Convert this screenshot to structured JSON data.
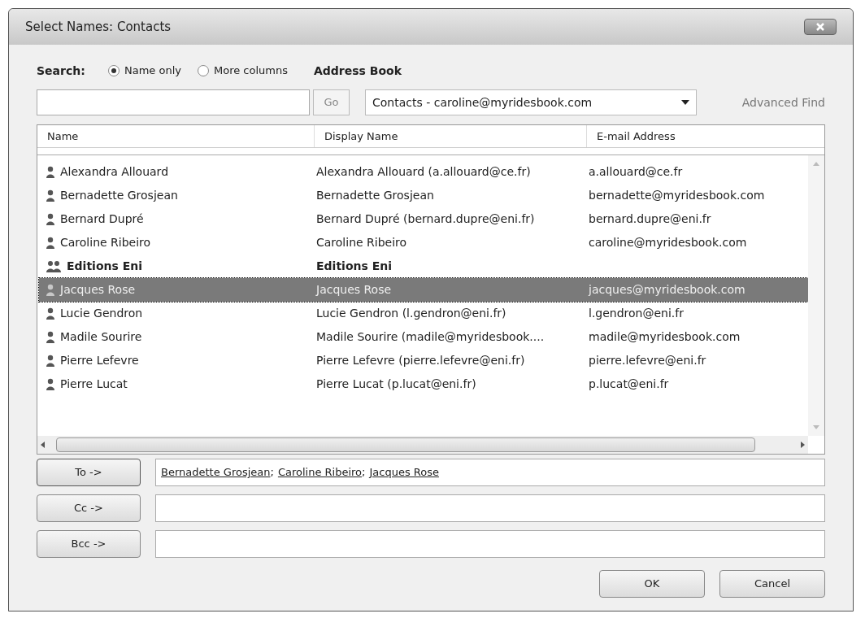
{
  "window": {
    "title": "Select Names: Contacts"
  },
  "search": {
    "label": "Search:",
    "options": [
      {
        "label": "Name only",
        "selected": true
      },
      {
        "label": "More columns",
        "selected": false
      }
    ],
    "go": "Go"
  },
  "address_book": {
    "label": "Address Book",
    "value": "Contacts - caroline@myridesbook.com",
    "advanced_find": "Advanced Find"
  },
  "table": {
    "columns": [
      "Name",
      "Display Name",
      "E-mail Address"
    ],
    "rows": [
      {
        "kind": "contact",
        "selected": false,
        "cells": [
          "Alexandra Allouard",
          "Alexandra Allouard (a.allouard@ce.fr)",
          "a.allouard@ce.fr"
        ]
      },
      {
        "kind": "contact",
        "selected": false,
        "cells": [
          "Bernadette Grosjean",
          "Bernadette Grosjean",
          "bernadette@myridesbook.com"
        ]
      },
      {
        "kind": "contact",
        "selected": false,
        "cells": [
          "Bernard Dupré",
          "Bernard Dupré (bernard.dupre@eni.fr)",
          "bernard.dupre@eni.fr"
        ]
      },
      {
        "kind": "contact",
        "selected": false,
        "cells": [
          "Caroline Ribeiro",
          "Caroline Ribeiro",
          "caroline@myridesbook.com"
        ]
      },
      {
        "kind": "group",
        "selected": false,
        "cells": [
          "Editions Eni",
          "Editions Eni",
          ""
        ]
      },
      {
        "kind": "contact",
        "selected": true,
        "cells": [
          "Jacques Rose",
          "Jacques Rose",
          "jacques@myridesbook.com"
        ]
      },
      {
        "kind": "contact",
        "selected": false,
        "cells": [
          "Lucie Gendron",
          "Lucie Gendron (l.gendron@eni.fr)",
          "l.gendron@eni.fr"
        ]
      },
      {
        "kind": "contact",
        "selected": false,
        "cells": [
          "Madile Sourire",
          "Madile Sourire (madile@myridesbook....",
          "madile@myridesbook.com"
        ]
      },
      {
        "kind": "contact",
        "selected": false,
        "cells": [
          "Pierre Lefevre",
          "Pierre Lefevre (pierre.lefevre@eni.fr)",
          "pierre.lefevre@eni.fr"
        ]
      },
      {
        "kind": "contact",
        "selected": false,
        "cells": [
          "Pierre Lucat",
          "Pierre Lucat (p.lucat@eni.fr)",
          "p.lucat@eni.fr"
        ]
      }
    ]
  },
  "recipients": [
    {
      "button": "To ->",
      "names": [
        {
          "name": "Bernadette Grosjean",
          "separator": ";"
        },
        {
          "name": "Caroline Ribeiro",
          "separator": ";"
        },
        {
          "name": "Jacques Rose"
        }
      ]
    },
    {
      "button": "Cc ->"
    },
    {
      "button": "Bcc ->"
    }
  ],
  "buttons": [
    "OK",
    "Cancel"
  ]
}
